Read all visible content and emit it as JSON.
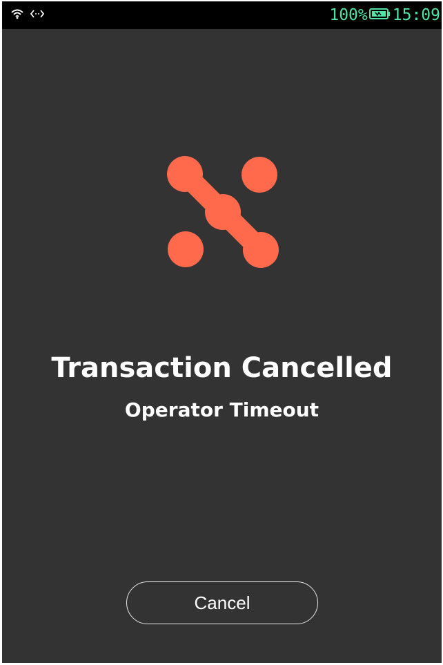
{
  "status_bar": {
    "left_icons": [
      "wifi-icon",
      "data-transfer-icon"
    ],
    "battery_percent": "100%",
    "battery_icon": "battery-icon",
    "time": "15:09",
    "text_color": "#4fe3a6"
  },
  "logo": {
    "icon": "brand-logo-icon",
    "color": "#ff6a4d"
  },
  "message": {
    "title": "Transaction Cancelled",
    "subtitle": "Operator Timeout"
  },
  "actions": {
    "cancel_label": "Cancel"
  },
  "colors": {
    "background": "#333333",
    "status_bar_background": "#000000",
    "text": "#ffffff"
  }
}
